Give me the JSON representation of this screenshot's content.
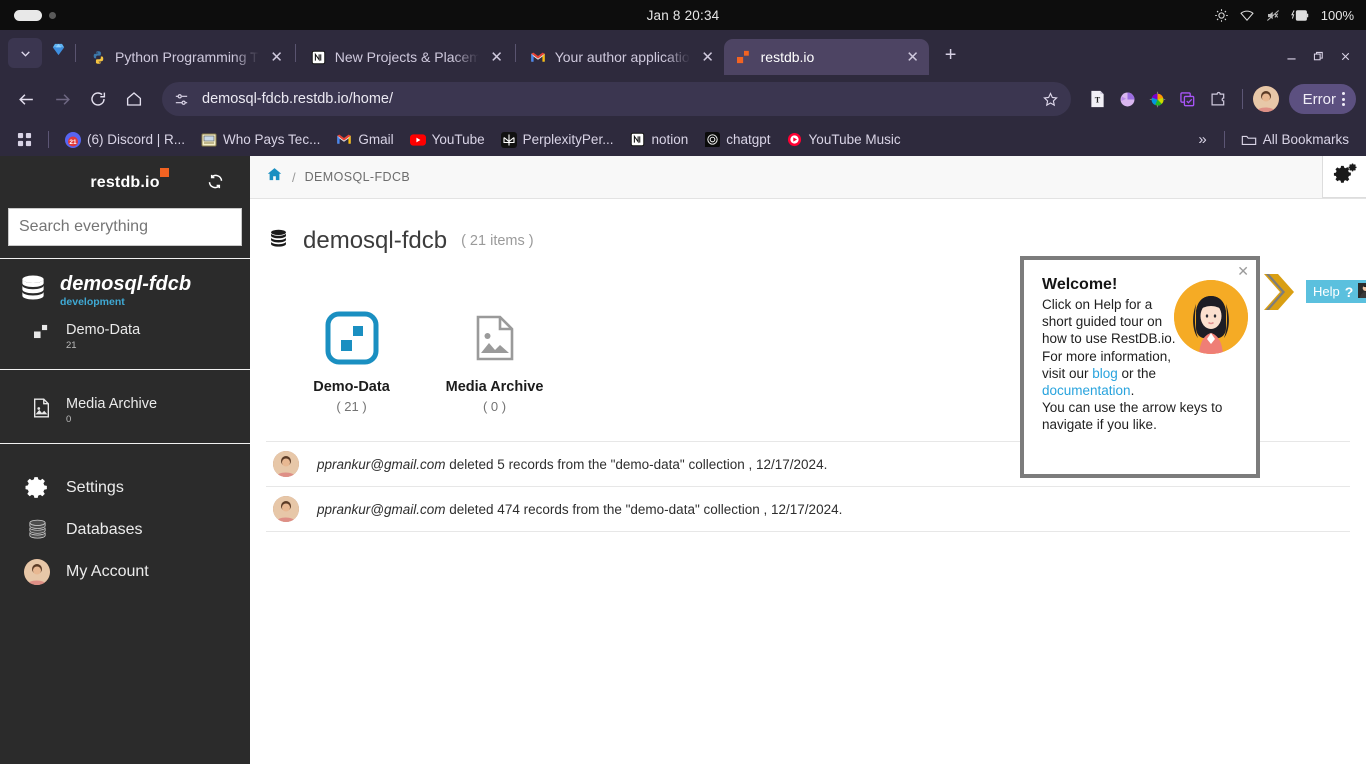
{
  "os_bar": {
    "clock": "Jan 8  20:34",
    "battery_percent": "100%",
    "tray_icons": [
      "brightness-icon",
      "wifi-icon",
      "volume-muted-icon",
      "battery-charging-icon"
    ]
  },
  "browser": {
    "tabs": [
      {
        "title": "Python Programming T",
        "favicon": "python-icon",
        "active": false
      },
      {
        "title": "New Projects & Placem",
        "favicon": "notion-icon",
        "active": false
      },
      {
        "title": "Your author applicatio",
        "favicon": "gmail-icon",
        "active": false
      },
      {
        "title": "restdb.io",
        "favicon": "restdb-icon",
        "active": true
      }
    ],
    "new_tab_label": "+",
    "window_controls": {
      "minimize": "minimize-icon",
      "maximize": "restore-icon",
      "close": "close-icon"
    },
    "toolbar": {
      "back": "back-arrow-icon",
      "forward": "forward-arrow-icon",
      "reload": "reload-icon",
      "home": "home-icon",
      "site_settings": "site-settings-icon",
      "url": "demosql-fdcb.restdb.io/home/",
      "bookmark_star": "star-icon",
      "extensions": [
        "text-extension-icon",
        "purple-extension-icon",
        "color-wheel-icon",
        "checklist-extension-icon",
        "puzzle-extension-icon"
      ],
      "profile": "profile-avatar",
      "error_label": "Error",
      "menu": "kebab-menu-icon"
    },
    "bookmarks": {
      "apps": "apps-grid-icon",
      "items": [
        {
          "label": "(6) Discord | R...",
          "icon": "discord-icon"
        },
        {
          "label": "Who Pays Tec...",
          "icon": "computer-icon"
        },
        {
          "label": "Gmail",
          "icon": "gmail-icon"
        },
        {
          "label": "YouTube",
          "icon": "youtube-icon"
        },
        {
          "label": "PerplexityPer...",
          "icon": "perplexity-icon"
        },
        {
          "label": "notion",
          "icon": "notion-icon"
        },
        {
          "label": "chatgpt",
          "icon": "openai-icon"
        },
        {
          "label": "YouTube Music",
          "icon": "youtube-music-icon"
        }
      ],
      "overflow": "»",
      "all_bookmarks": "All Bookmarks"
    }
  },
  "sidebar": {
    "brand": "restdb.io",
    "refresh_icon": "refresh-icon",
    "search_placeholder": "Search everything",
    "database": {
      "name": "demosql-fdcb",
      "environment": "development",
      "icon": "database-icon"
    },
    "collections": [
      {
        "label": "Demo-Data",
        "count": "21",
        "icon": "collection-icon"
      },
      {
        "label": "Media Archive",
        "count": "0",
        "icon": "media-icon"
      }
    ],
    "footer": [
      {
        "label": "Settings",
        "icon": "gear-icon"
      },
      {
        "label": "Databases",
        "icon": "databases-icon"
      },
      {
        "label": "My Account",
        "icon": "account-avatar"
      }
    ]
  },
  "main": {
    "breadcrumb": {
      "home_icon": "home-icon",
      "separator": "/",
      "current": "DEMOSQL-FDCB"
    },
    "settings_gear": "gears-icon",
    "page_title": "demosql-fdcb",
    "page_count": "( 21 items )",
    "tiles": [
      {
        "name": "Demo-Data",
        "count": "( 21 )",
        "icon": "collection-tile-icon"
      },
      {
        "name": "Media Archive",
        "count": "( 0 )",
        "icon": "media-tile-icon"
      }
    ],
    "activity": [
      {
        "user": "pprankur@gmail.com",
        "text": " deleted 5 records from the \"demo-data\" collection , 12/17/2024.",
        "avatar": "user-avatar"
      },
      {
        "user": "pprankur@gmail.com",
        "text": " deleted 474 records from the \"demo-data\" collection , 12/17/2024.",
        "avatar": "user-avatar"
      }
    ]
  },
  "welcome_popup": {
    "close_icon": "close-icon",
    "title": "Welcome!",
    "line1": "Click on Help for a short guided tour on how to use RestDB.io. For more information, visit our ",
    "link_blog": "blog",
    "mid": " or the ",
    "link_docs": "documentation",
    "period": ".",
    "line2": "You can use the arrow keys to navigate if you like.",
    "avatar": "woman-avatar-icon",
    "help_button": {
      "label": "Help",
      "question_mark": "?",
      "icon": "person-icon"
    }
  },
  "colors": {
    "brand_orange": "#f26322",
    "accent_blue": "#1a8fc1",
    "link_blue": "#28a3dd",
    "sidebar_bg": "#2b2b2b",
    "browser_chrome": "#2e2a3d",
    "help_button": "#5bc0de",
    "env_blue": "#3fa9d4"
  }
}
